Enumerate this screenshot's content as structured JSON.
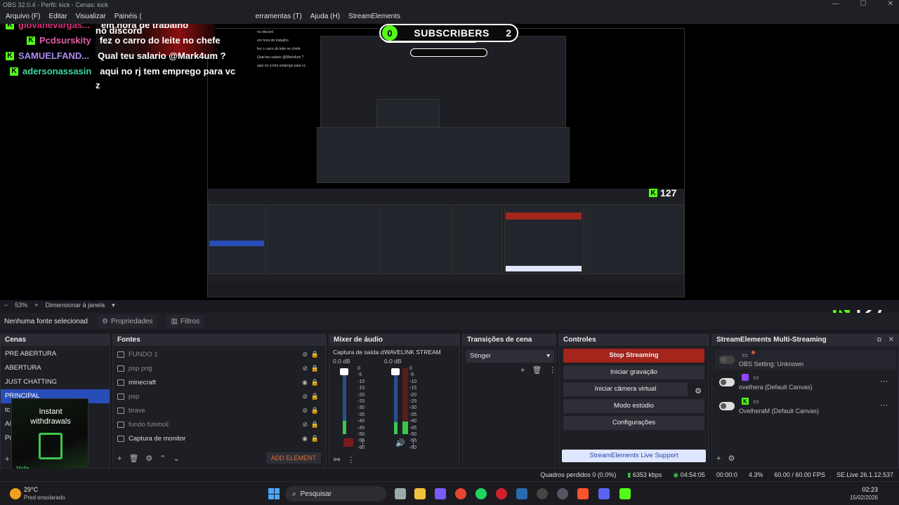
{
  "window": {
    "title": "OBS 32.0.4 - Perfil: kick - Cenas: kick"
  },
  "menu": [
    "Arquivo (F)",
    "Editar",
    "Visualizar",
    "Painéis (",
    "erramentas (T)",
    "Ajuda (H)",
    "StreamElements"
  ],
  "chat": {
    "overlay_title": "no discord",
    "lines": [
      {
        "user": "giovanevargas...",
        "user_color": "#e0307a",
        "text": "em hora de trabalho"
      },
      {
        "user": "Pcdsurskity",
        "user_color": "#e05fa8",
        "text": "fez o carro do leite no chefe"
      },
      {
        "user": "SAMUELFAND...",
        "user_color": "#a98cf0",
        "text": "Qual teu salario @Mark4um ?"
      },
      {
        "user": "adersonassasin",
        "user_color": "#3fd8a0",
        "text": "aqui no rj tem emprego para vc"
      }
    ],
    "trailing": "z"
  },
  "subscribers": {
    "left": "0",
    "label": "SUBSCRIBERS",
    "right": "2"
  },
  "kick_followers": "127",
  "zoom": {
    "minus": "−",
    "value": "53%",
    "plus": "+",
    "fit_label": "Dimensionar à janela"
  },
  "source_bar": {
    "selected": "Nenhuma fonte selecionad",
    "properties": "Propriedades",
    "filters": "Filtros"
  },
  "scenes": {
    "title": "Cenas",
    "items": [
      "PRE ABERTURA",
      "ABERTURA",
      "JUST CHATTING",
      "PRINCIPAL",
      "tc",
      "Al",
      "Pi"
    ],
    "selected_index": 3
  },
  "sources": {
    "title": "Fontes",
    "items": [
      {
        "name": "FUNDO 1",
        "visible": false
      },
      {
        "name": "psp png",
        "visible": false
      },
      {
        "name": "minecraft",
        "visible": true
      },
      {
        "name": "psp",
        "visible": false
      },
      {
        "name": "brave",
        "visible": false
      },
      {
        "name": "fundo futeboll",
        "visible": false
      },
      {
        "name": "Captura de monitor",
        "visible": true
      }
    ],
    "add_label": "ADD ELEMENT"
  },
  "mixer": {
    "title": "Mixer de áudio",
    "channels": [
      {
        "name": "Captura de saída d",
        "db": "0.0 dB",
        "level": 0.2
      },
      {
        "name": "WAVELINK STREAM",
        "db": "0.0 dB",
        "level": 0.18
      }
    ],
    "scale": [
      "0",
      "-5",
      "-10",
      "-15",
      "-20",
      "-25",
      "-30",
      "-35",
      "-40",
      "-45",
      "-50",
      "-55",
      "-60"
    ]
  },
  "transitions": {
    "title": "Transições de cena",
    "selected": "Stinger"
  },
  "controls": {
    "title": "Controles",
    "stop_streaming": "Stop Streaming",
    "start_recording": "Iniciar gravação",
    "virtual_camera": "Iniciar câmera virtual",
    "studio_mode": "Modo estúdio",
    "settings": "Configurações",
    "support": "StreamElements Live Support"
  },
  "multistream": {
    "title": "StreamElements Multi-Streaming",
    "items": [
      {
        "name": "OBS Setting: Unknown",
        "on": false,
        "platform": "obs"
      },
      {
        "name": "ovelhera (Default Canvas)",
        "on": true,
        "platform": "twitch"
      },
      {
        "name": "OvelheraM (Default Canvas)",
        "on": true,
        "platform": "kick"
      }
    ]
  },
  "status": {
    "dropped": "Quadros perdidos 0 (0.0%)",
    "bitrate": "6353 kbps",
    "stream_time": "04:54:05",
    "rec_time": "00:00:0",
    "cpu": "4.3%",
    "fps": "60.00 / 60.00 FPS",
    "version": "SE.Live 26.1.12.537"
  },
  "widget": {
    "line1": "Instant",
    "line2": "withdrawals",
    "brand": "Valo"
  },
  "taskbar": {
    "weather_temp": "29°C",
    "weather_desc": "Pred ensolarado",
    "search": "Pesquisar",
    "time": "02:23",
    "date": "15/02/2026"
  },
  "colors": {
    "kick_green": "#53fc18",
    "stop_red": "#a3251c",
    "selection_blue": "#284cb8"
  }
}
